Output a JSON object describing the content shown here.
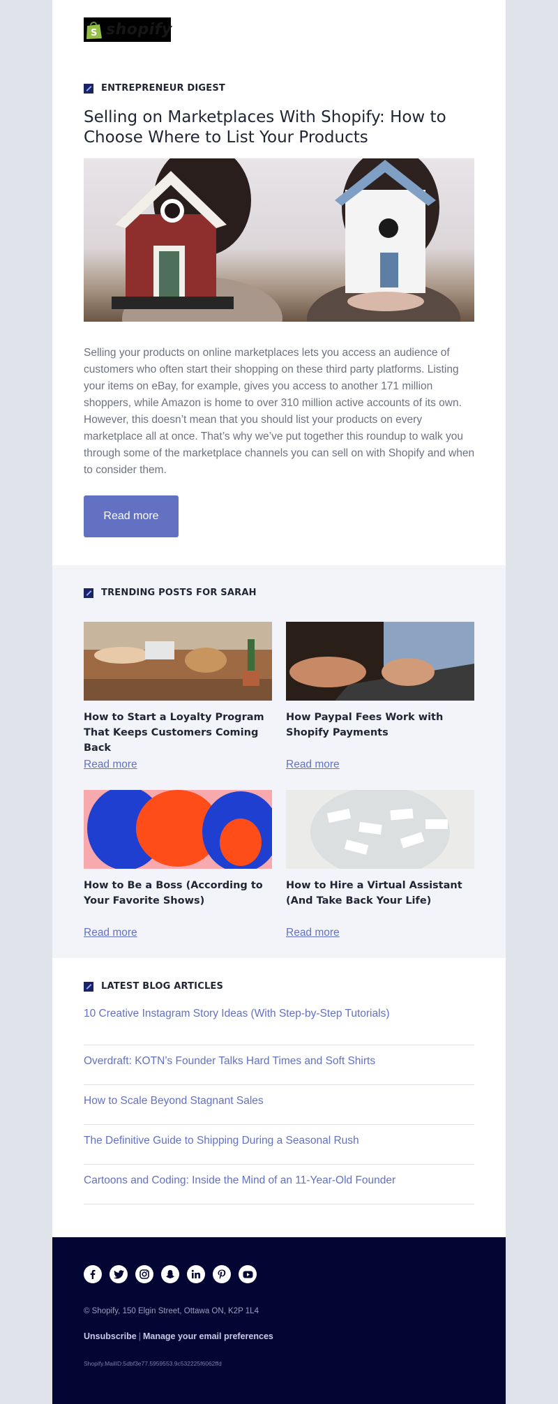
{
  "brand": {
    "logo_text": "shopify"
  },
  "hero": {
    "section_label": "ENTREPRENEUR DIGEST",
    "title": "Selling on Marketplaces With Shopify: How to Choose Where to List Your Products",
    "body": "Selling your products on online marketplaces lets you access an audience of customers who often start their shopping on these third party platforms. Listing your items on eBay, for example, gives you access to another 171 million shoppers, while Amazon is home to over 310 million active accounts of its own. However, this doesn’t mean that you should list your products on every marketplace all at once. That’s why we’ve put together this roundup to walk you through some of the marketplace channels you can sell on with Shopify and when to consider them.",
    "button_label": "Read more"
  },
  "trending": {
    "section_label": "TRENDING POSTS FOR SARAH",
    "posts": [
      {
        "title": "How to Start a Loyalty Program That Keeps Customers Coming Back",
        "link": "Read more"
      },
      {
        "title": "How Paypal Fees Work with Shopify Payments",
        "link": "Read more"
      },
      {
        "title": "How to Be a Boss (According to Your Favorite Shows)",
        "link": "Read more"
      },
      {
        "title": "How to Hire a Virtual Assistant (And Take Back Your Life)",
        "link": "Read more"
      }
    ]
  },
  "latest": {
    "section_label": "LATEST BLOG ARTICLES",
    "articles": [
      "10 Creative Instagram Story Ideas (With Step-by-Step Tutorials)",
      "Overdraft: KOTN’s Founder Talks Hard Times and Soft Shirts",
      "How to Scale Beyond Stagnant Sales",
      "The Definitive Guide to Shipping During a Seasonal Rush",
      "Cartoons and Coding: Inside the Mind of an 11-Year-Old Founder"
    ]
  },
  "footer": {
    "social_icons": [
      "facebook-icon",
      "twitter-icon",
      "instagram-icon",
      "snapchat-icon",
      "linkedin-icon",
      "pinterest-icon",
      "youtube-icon"
    ],
    "address": "© Shopify,  150 Elgin Street, Ottawa ON, K2P 1L4",
    "unsubscribe": "Unsubscribe",
    "separator": "|",
    "manage": "Manage your email preferences",
    "mail_id": "Shopify.MailID:5dbf3e77.5959553.9c532225f6062ffd"
  },
  "colors": {
    "page_background": "#e0e3ea",
    "accent": "#6371c2",
    "footer_background": "#030533",
    "trending_background": "#f3f4fa",
    "heading_text": "#1f2533",
    "body_text": "#6c7281"
  }
}
